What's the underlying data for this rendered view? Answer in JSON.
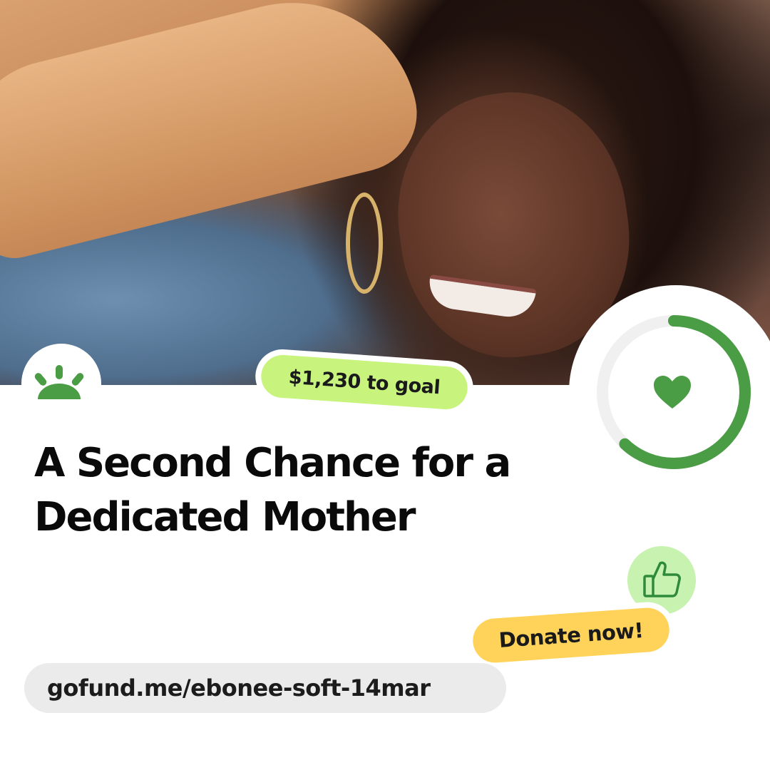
{
  "campaign": {
    "photo_alt": "Smiling woman with dark hair and hoop earrings",
    "goal_badge": "$1,230 to goal",
    "title": "A Second Chance for a Dedicated Mother",
    "donate_label": "Donate now!",
    "url": "gofund.me/ebonee-soft-14mar",
    "progress_fraction": 0.62
  },
  "colors": {
    "brand_green": "#4a9c45",
    "goal_pill": "#c8f47e",
    "donate_pill": "#ffd35a",
    "url_pill": "#ebebeb",
    "thumb_badge": "#c8f2b0"
  },
  "icons": {
    "logo": "gofundme-logo-icon",
    "heart": "heart-icon",
    "thumb": "thumbs-up-icon"
  }
}
